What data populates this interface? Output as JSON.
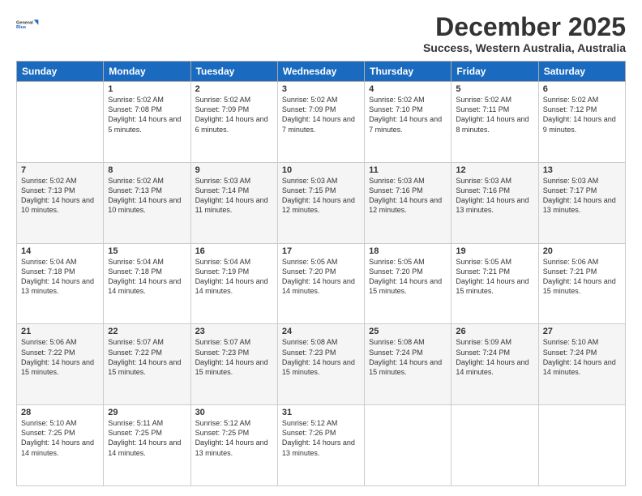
{
  "header": {
    "logo_line1": "General",
    "logo_line2": "Blue",
    "month_title": "December 2025",
    "location": "Success, Western Australia, Australia"
  },
  "weekdays": [
    "Sunday",
    "Monday",
    "Tuesday",
    "Wednesday",
    "Thursday",
    "Friday",
    "Saturday"
  ],
  "weeks": [
    [
      {
        "day": "",
        "sunrise": "",
        "sunset": "",
        "daylight": ""
      },
      {
        "day": "1",
        "sunrise": "Sunrise: 5:02 AM",
        "sunset": "Sunset: 7:08 PM",
        "daylight": "Daylight: 14 hours and 5 minutes."
      },
      {
        "day": "2",
        "sunrise": "Sunrise: 5:02 AM",
        "sunset": "Sunset: 7:09 PM",
        "daylight": "Daylight: 14 hours and 6 minutes."
      },
      {
        "day": "3",
        "sunrise": "Sunrise: 5:02 AM",
        "sunset": "Sunset: 7:09 PM",
        "daylight": "Daylight: 14 hours and 7 minutes."
      },
      {
        "day": "4",
        "sunrise": "Sunrise: 5:02 AM",
        "sunset": "Sunset: 7:10 PM",
        "daylight": "Daylight: 14 hours and 7 minutes."
      },
      {
        "day": "5",
        "sunrise": "Sunrise: 5:02 AM",
        "sunset": "Sunset: 7:11 PM",
        "daylight": "Daylight: 14 hours and 8 minutes."
      },
      {
        "day": "6",
        "sunrise": "Sunrise: 5:02 AM",
        "sunset": "Sunset: 7:12 PM",
        "daylight": "Daylight: 14 hours and 9 minutes."
      }
    ],
    [
      {
        "day": "7",
        "sunrise": "Sunrise: 5:02 AM",
        "sunset": "Sunset: 7:13 PM",
        "daylight": "Daylight: 14 hours and 10 minutes."
      },
      {
        "day": "8",
        "sunrise": "Sunrise: 5:02 AM",
        "sunset": "Sunset: 7:13 PM",
        "daylight": "Daylight: 14 hours and 10 minutes."
      },
      {
        "day": "9",
        "sunrise": "Sunrise: 5:03 AM",
        "sunset": "Sunset: 7:14 PM",
        "daylight": "Daylight: 14 hours and 11 minutes."
      },
      {
        "day": "10",
        "sunrise": "Sunrise: 5:03 AM",
        "sunset": "Sunset: 7:15 PM",
        "daylight": "Daylight: 14 hours and 12 minutes."
      },
      {
        "day": "11",
        "sunrise": "Sunrise: 5:03 AM",
        "sunset": "Sunset: 7:16 PM",
        "daylight": "Daylight: 14 hours and 12 minutes."
      },
      {
        "day": "12",
        "sunrise": "Sunrise: 5:03 AM",
        "sunset": "Sunset: 7:16 PM",
        "daylight": "Daylight: 14 hours and 13 minutes."
      },
      {
        "day": "13",
        "sunrise": "Sunrise: 5:03 AM",
        "sunset": "Sunset: 7:17 PM",
        "daylight": "Daylight: 14 hours and 13 minutes."
      }
    ],
    [
      {
        "day": "14",
        "sunrise": "Sunrise: 5:04 AM",
        "sunset": "Sunset: 7:18 PM",
        "daylight": "Daylight: 14 hours and 13 minutes."
      },
      {
        "day": "15",
        "sunrise": "Sunrise: 5:04 AM",
        "sunset": "Sunset: 7:18 PM",
        "daylight": "Daylight: 14 hours and 14 minutes."
      },
      {
        "day": "16",
        "sunrise": "Sunrise: 5:04 AM",
        "sunset": "Sunset: 7:19 PM",
        "daylight": "Daylight: 14 hours and 14 minutes."
      },
      {
        "day": "17",
        "sunrise": "Sunrise: 5:05 AM",
        "sunset": "Sunset: 7:20 PM",
        "daylight": "Daylight: 14 hours and 14 minutes."
      },
      {
        "day": "18",
        "sunrise": "Sunrise: 5:05 AM",
        "sunset": "Sunset: 7:20 PM",
        "daylight": "Daylight: 14 hours and 15 minutes."
      },
      {
        "day": "19",
        "sunrise": "Sunrise: 5:05 AM",
        "sunset": "Sunset: 7:21 PM",
        "daylight": "Daylight: 14 hours and 15 minutes."
      },
      {
        "day": "20",
        "sunrise": "Sunrise: 5:06 AM",
        "sunset": "Sunset: 7:21 PM",
        "daylight": "Daylight: 14 hours and 15 minutes."
      }
    ],
    [
      {
        "day": "21",
        "sunrise": "Sunrise: 5:06 AM",
        "sunset": "Sunset: 7:22 PM",
        "daylight": "Daylight: 14 hours and 15 minutes."
      },
      {
        "day": "22",
        "sunrise": "Sunrise: 5:07 AM",
        "sunset": "Sunset: 7:22 PM",
        "daylight": "Daylight: 14 hours and 15 minutes."
      },
      {
        "day": "23",
        "sunrise": "Sunrise: 5:07 AM",
        "sunset": "Sunset: 7:23 PM",
        "daylight": "Daylight: 14 hours and 15 minutes."
      },
      {
        "day": "24",
        "sunrise": "Sunrise: 5:08 AM",
        "sunset": "Sunset: 7:23 PM",
        "daylight": "Daylight: 14 hours and 15 minutes."
      },
      {
        "day": "25",
        "sunrise": "Sunrise: 5:08 AM",
        "sunset": "Sunset: 7:24 PM",
        "daylight": "Daylight: 14 hours and 15 minutes."
      },
      {
        "day": "26",
        "sunrise": "Sunrise: 5:09 AM",
        "sunset": "Sunset: 7:24 PM",
        "daylight": "Daylight: 14 hours and 14 minutes."
      },
      {
        "day": "27",
        "sunrise": "Sunrise: 5:10 AM",
        "sunset": "Sunset: 7:24 PM",
        "daylight": "Daylight: 14 hours and 14 minutes."
      }
    ],
    [
      {
        "day": "28",
        "sunrise": "Sunrise: 5:10 AM",
        "sunset": "Sunset: 7:25 PM",
        "daylight": "Daylight: 14 hours and 14 minutes."
      },
      {
        "day": "29",
        "sunrise": "Sunrise: 5:11 AM",
        "sunset": "Sunset: 7:25 PM",
        "daylight": "Daylight: 14 hours and 14 minutes."
      },
      {
        "day": "30",
        "sunrise": "Sunrise: 5:12 AM",
        "sunset": "Sunset: 7:25 PM",
        "daylight": "Daylight: 14 hours and 13 minutes."
      },
      {
        "day": "31",
        "sunrise": "Sunrise: 5:12 AM",
        "sunset": "Sunset: 7:26 PM",
        "daylight": "Daylight: 14 hours and 13 minutes."
      },
      {
        "day": "",
        "sunrise": "",
        "sunset": "",
        "daylight": ""
      },
      {
        "day": "",
        "sunrise": "",
        "sunset": "",
        "daylight": ""
      },
      {
        "day": "",
        "sunrise": "",
        "sunset": "",
        "daylight": ""
      }
    ]
  ]
}
